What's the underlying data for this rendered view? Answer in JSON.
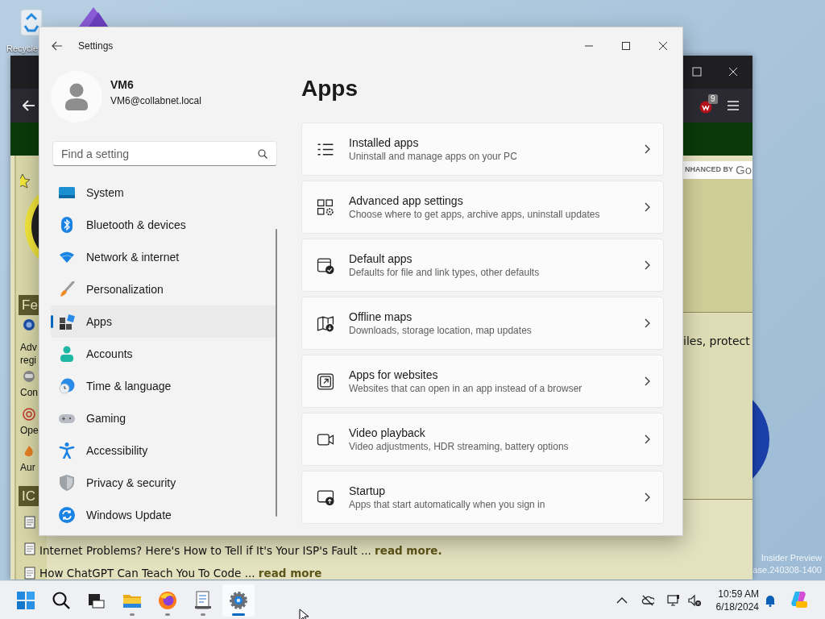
{
  "desktop": {
    "icons": [
      {
        "label": "Recycle"
      }
    ],
    "build_info": [
      "Insider Preview",
      "ase.240308-1400"
    ]
  },
  "browser": {
    "extension_badge": "9",
    "search_attribution": "NHANCED BY",
    "search_logo": "Go",
    "sidebar_headers": [
      "Fe",
      "IC"
    ],
    "sidebar_fragments": [
      {
        "lines": [
          "Adv",
          "regi"
        ]
      },
      {
        "lines": [
          "Con"
        ]
      },
      {
        "lines": [
          "Ope"
        ]
      },
      {
        "lines": [
          "Aur"
        ]
      }
    ],
    "body_fragment": "iles, protect",
    "headlines": [
      {
        "text": "Internet Problems? Here's How to Tell if It's Your ISP's Fault ...",
        "more": "read more."
      },
      {
        "text": "How ChatGPT Can Teach You To Code ...",
        "more": "read more"
      }
    ]
  },
  "settings": {
    "title": "Settings",
    "user": {
      "name": "VM6",
      "email": "VM6@collabnet.local"
    },
    "search": {
      "placeholder": "Find a setting"
    },
    "nav": [
      {
        "label": "System",
        "kind": "system",
        "selected": false
      },
      {
        "label": "Bluetooth & devices",
        "kind": "bluetooth",
        "selected": false
      },
      {
        "label": "Network & internet",
        "kind": "network",
        "selected": false
      },
      {
        "label": "Personalization",
        "kind": "personalization",
        "selected": false
      },
      {
        "label": "Apps",
        "kind": "apps",
        "selected": true
      },
      {
        "label": "Accounts",
        "kind": "accounts",
        "selected": false
      },
      {
        "label": "Time & language",
        "kind": "time",
        "selected": false
      },
      {
        "label": "Gaming",
        "kind": "gaming",
        "selected": false
      },
      {
        "label": "Accessibility",
        "kind": "accessibility",
        "selected": false
      },
      {
        "label": "Privacy & security",
        "kind": "privacy",
        "selected": false
      },
      {
        "label": "Windows Update",
        "kind": "update",
        "selected": false
      }
    ],
    "page_title": "Apps",
    "cards": [
      {
        "title": "Installed apps",
        "subtitle": "Uninstall and manage apps on your PC",
        "kind": "list"
      },
      {
        "title": "Advanced app settings",
        "subtitle": "Choose where to get apps, archive apps, uninstall updates",
        "kind": "advanced"
      },
      {
        "title": "Default apps",
        "subtitle": "Defaults for file and link types, other defaults",
        "kind": "default"
      },
      {
        "title": "Offline maps",
        "subtitle": "Downloads, storage location, map updates",
        "kind": "map"
      },
      {
        "title": "Apps for websites",
        "subtitle": "Websites that can open in an app instead of a browser",
        "kind": "link"
      },
      {
        "title": "Video playback",
        "subtitle": "Video adjustments, HDR streaming, battery options",
        "kind": "video"
      },
      {
        "title": "Startup",
        "subtitle": "Apps that start automatically when you sign in",
        "kind": "startup"
      }
    ]
  },
  "taskbar": {
    "apps": [
      {
        "kind": "start",
        "running": false,
        "active": false
      },
      {
        "kind": "search",
        "running": false,
        "active": false
      },
      {
        "kind": "taskview",
        "running": false,
        "active": false
      },
      {
        "kind": "explorer",
        "running": true,
        "active": false
      },
      {
        "kind": "firefox",
        "running": true,
        "active": false
      },
      {
        "kind": "notepad",
        "running": true,
        "active": false
      },
      {
        "kind": "settings",
        "running": true,
        "active": true
      }
    ],
    "clock": {
      "time": "10:59 AM",
      "date": "6/18/2024"
    }
  }
}
